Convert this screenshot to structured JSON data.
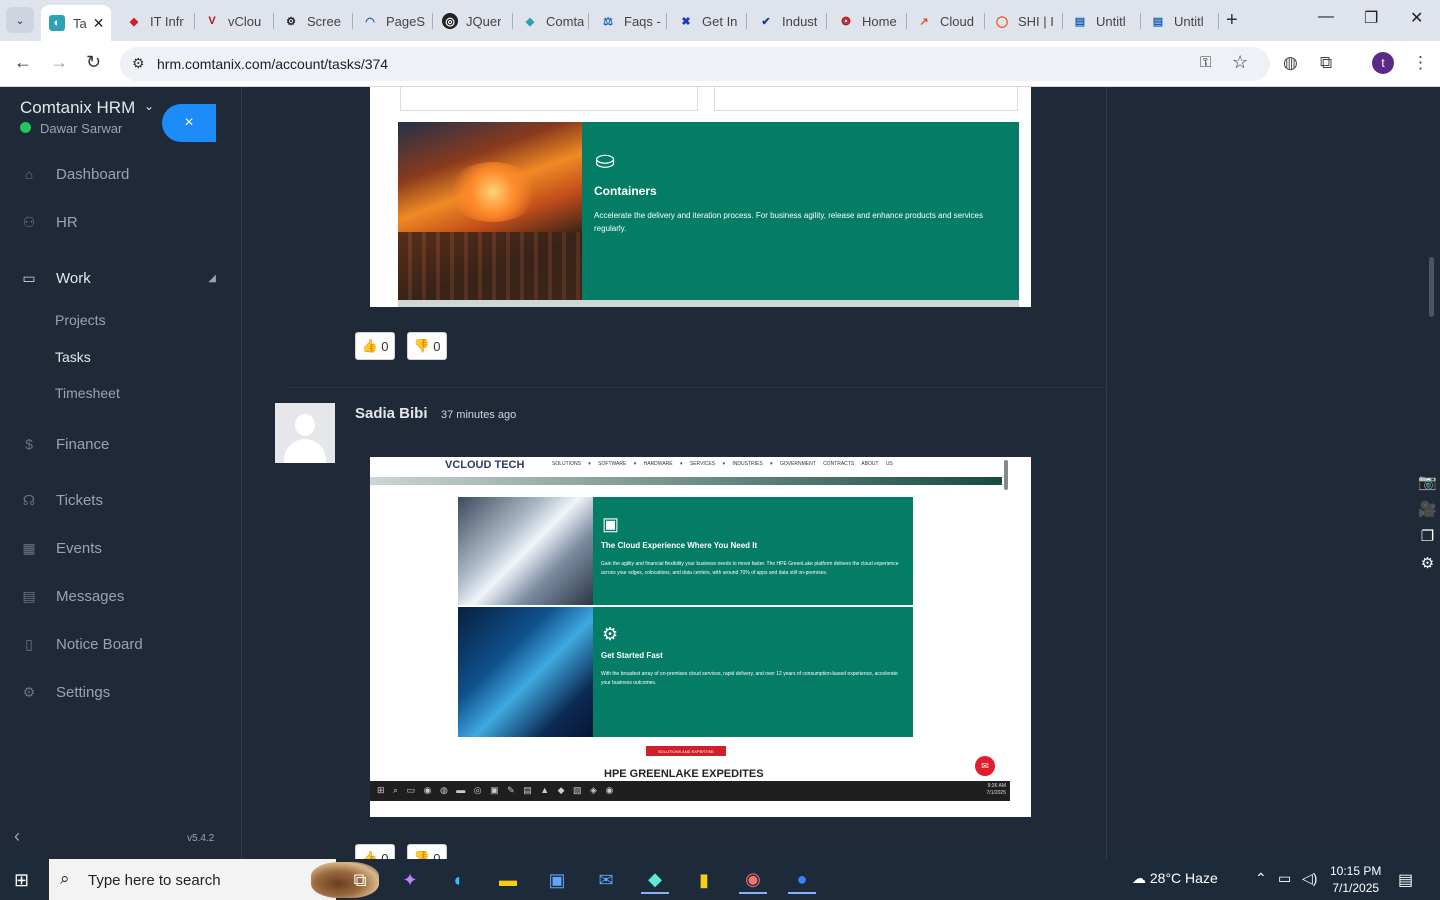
{
  "browser": {
    "tabs": [
      {
        "label": "Ta",
        "active": true
      },
      {
        "label": "IT Infr"
      },
      {
        "label": "vClou"
      },
      {
        "label": "Scree"
      },
      {
        "label": "PageS"
      },
      {
        "label": "JQuer"
      },
      {
        "label": "Comta"
      },
      {
        "label": "Faqs -"
      },
      {
        "label": "Get In"
      },
      {
        "label": "Indust"
      },
      {
        "label": "Home"
      },
      {
        "label": "Cloud"
      },
      {
        "label": "SHI | I"
      },
      {
        "label": "Untitl"
      },
      {
        "label": "Untitl"
      }
    ],
    "url": "hrm.comtanix.com/account/tasks/374",
    "profile_initial": "t"
  },
  "sidebar": {
    "brand": "Comtanix HRM",
    "user": "Dawar Sarwar",
    "close_label": "×",
    "items": [
      {
        "label": "Dashboard",
        "icon": "home-icon"
      },
      {
        "label": "HR",
        "icon": "users-icon"
      },
      {
        "label": "Work",
        "icon": "briefcase-icon"
      },
      {
        "label": "Finance",
        "icon": "dollar-icon"
      },
      {
        "label": "Tickets",
        "icon": "headset-icon"
      },
      {
        "label": "Events",
        "icon": "calendar-icon"
      },
      {
        "label": "Messages",
        "icon": "message-icon"
      },
      {
        "label": "Notice Board",
        "icon": "clipboard-icon"
      },
      {
        "label": "Settings",
        "icon": "gear-icon"
      }
    ],
    "work_sub": [
      "Projects",
      "Tasks",
      "Timesheet"
    ],
    "version": "v5.4.2"
  },
  "comments": {
    "first": {
      "shot": {
        "title": "Containers",
        "desc": "Accelerate the delivery and iteration process. For business agility, release and enhance products and services regularly."
      },
      "likes": "0",
      "dislikes": "0"
    },
    "second": {
      "author": "Sadia Bibi",
      "time": "37 minutes ago",
      "shot": {
        "logo": "VCLOUD TECH",
        "menu": "SOLUTIONS ▾ SOFTWARE ▾ HARDWARE ▾ SERVICES ▾ INDUSTRIES ▾ GOVERNMENT CONTRACTS ABOUT US",
        "card1_title": "The Cloud Experience Where You Need It",
        "card1_desc": "Gain the agility and financial flexibility your business needs to move faster. The HPE GreenLake platform delivers the cloud experience across your edges, colocations, and data centers, with around 70% of apps and data still on-premises.",
        "card2_title": "Get Started Fast",
        "card2_desc": "With the broadest array of on-premises cloud services, rapid delivery, and over 12 years of consumption-based experience, accelerate your business outcomes.",
        "tag": "SOLUTIONS AND EXPERTISE",
        "heading": "HPE GREENLAKE EXPEDITES",
        "tb_time": "9:36 AM",
        "tb_date": "7/1/2025"
      },
      "likes": "0",
      "dislikes": "0"
    }
  },
  "taskbar": {
    "search_placeholder": "Type here to search",
    "weather": "28°C  Haze",
    "time": "10:15 PM",
    "date": "7/1/2025"
  }
}
